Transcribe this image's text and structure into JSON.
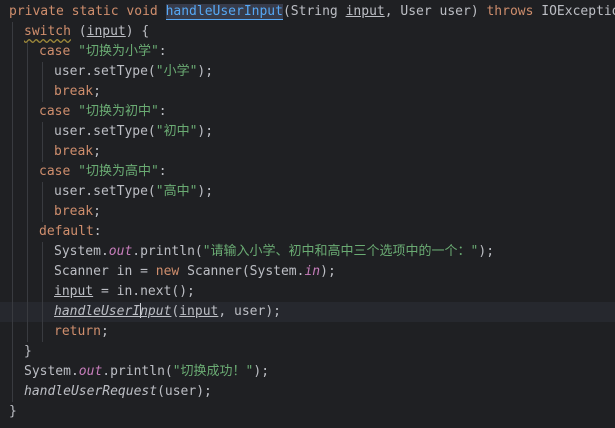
{
  "editor": {
    "language": "Java",
    "current_line": 15,
    "lines": [
      {
        "indent": 0,
        "tokens": [
          {
            "t": "private ",
            "c": "kw"
          },
          {
            "t": "static ",
            "c": "kw"
          },
          {
            "t": "void ",
            "c": "kw"
          },
          {
            "t": "handleUserInput",
            "c": "fn hl"
          },
          {
            "t": "(String ",
            "c": ""
          },
          {
            "t": "input",
            "c": "under"
          },
          {
            "t": ", User user) ",
            "c": ""
          },
          {
            "t": "throws ",
            "c": "kw"
          },
          {
            "t": "IOException {",
            "c": ""
          }
        ]
      },
      {
        "indent": 1,
        "tokens": [
          {
            "t": "switch",
            "c": "kw-under"
          },
          {
            "t": " (",
            "c": ""
          },
          {
            "t": "input",
            "c": "under"
          },
          {
            "t": ") {",
            "c": ""
          }
        ]
      },
      {
        "indent": 2,
        "tokens": [
          {
            "t": "case ",
            "c": "kw"
          },
          {
            "t": "\"切换为小学\"",
            "c": "str"
          },
          {
            "t": ":",
            "c": ""
          }
        ]
      },
      {
        "indent": 3,
        "tokens": [
          {
            "t": "user.setType(",
            "c": ""
          },
          {
            "t": "\"小学\"",
            "c": "str"
          },
          {
            "t": ");",
            "c": ""
          }
        ]
      },
      {
        "indent": 3,
        "tokens": [
          {
            "t": "break",
            "c": "kw"
          },
          {
            "t": ";",
            "c": ""
          }
        ]
      },
      {
        "indent": 2,
        "tokens": [
          {
            "t": "case ",
            "c": "kw"
          },
          {
            "t": "\"切换为初中\"",
            "c": "str"
          },
          {
            "t": ":",
            "c": ""
          }
        ]
      },
      {
        "indent": 3,
        "tokens": [
          {
            "t": "user.setType(",
            "c": ""
          },
          {
            "t": "\"初中\"",
            "c": "str"
          },
          {
            "t": ");",
            "c": ""
          }
        ]
      },
      {
        "indent": 3,
        "tokens": [
          {
            "t": "break",
            "c": "kw"
          },
          {
            "t": ";",
            "c": ""
          }
        ]
      },
      {
        "indent": 2,
        "tokens": [
          {
            "t": "case ",
            "c": "kw"
          },
          {
            "t": "\"切换为高中\"",
            "c": "str"
          },
          {
            "t": ":",
            "c": ""
          }
        ]
      },
      {
        "indent": 3,
        "tokens": [
          {
            "t": "user.setType(",
            "c": ""
          },
          {
            "t": "\"高中\"",
            "c": "str"
          },
          {
            "t": ");",
            "c": ""
          }
        ]
      },
      {
        "indent": 3,
        "tokens": [
          {
            "t": "break",
            "c": "kw"
          },
          {
            "t": ";",
            "c": ""
          }
        ]
      },
      {
        "indent": 2,
        "tokens": [
          {
            "t": "default",
            "c": "kw"
          },
          {
            "t": ":",
            "c": ""
          }
        ]
      },
      {
        "indent": 3,
        "tokens": [
          {
            "t": "System.",
            "c": ""
          },
          {
            "t": "out",
            "c": "field"
          },
          {
            "t": ".println(",
            "c": ""
          },
          {
            "t": "\"请输入小学、初中和高中三个选项中的一个：\"",
            "c": "str"
          },
          {
            "t": ");",
            "c": ""
          }
        ]
      },
      {
        "indent": 3,
        "tokens": [
          {
            "t": "Scanner in = ",
            "c": ""
          },
          {
            "t": "new ",
            "c": "kw"
          },
          {
            "t": "Scanner(System.",
            "c": ""
          },
          {
            "t": "in",
            "c": "field"
          },
          {
            "t": ");",
            "c": ""
          }
        ]
      },
      {
        "indent": 3,
        "tokens": [
          {
            "t": "input",
            "c": "under"
          },
          {
            "t": " = in.next();",
            "c": ""
          }
        ]
      },
      {
        "indent": 3,
        "tokens": [
          {
            "t": "handleUserI",
            "c": "ital under"
          },
          {
            "t": "|",
            "c": "caret"
          },
          {
            "t": "nput",
            "c": "ital under"
          },
          {
            "t": "(",
            "c": ""
          },
          {
            "t": "input",
            "c": "under"
          },
          {
            "t": ", user);",
            "c": ""
          }
        ]
      },
      {
        "indent": 3,
        "tokens": [
          {
            "t": "return",
            "c": "kw"
          },
          {
            "t": ";",
            "c": ""
          }
        ]
      },
      {
        "indent": 1,
        "tokens": [
          {
            "t": "}",
            "c": ""
          }
        ]
      },
      {
        "indent": 1,
        "tokens": [
          {
            "t": "System.",
            "c": ""
          },
          {
            "t": "out",
            "c": "field"
          },
          {
            "t": ".println(",
            "c": ""
          },
          {
            "t": "\"切换成功！\"",
            "c": "str"
          },
          {
            "t": ");",
            "c": ""
          }
        ]
      },
      {
        "indent": 1,
        "tokens": [
          {
            "t": "handleUserRequest",
            "c": "ital"
          },
          {
            "t": "(user);",
            "c": ""
          }
        ]
      },
      {
        "indent": 0,
        "tokens": [
          {
            "t": "}",
            "c": ""
          }
        ]
      }
    ]
  }
}
